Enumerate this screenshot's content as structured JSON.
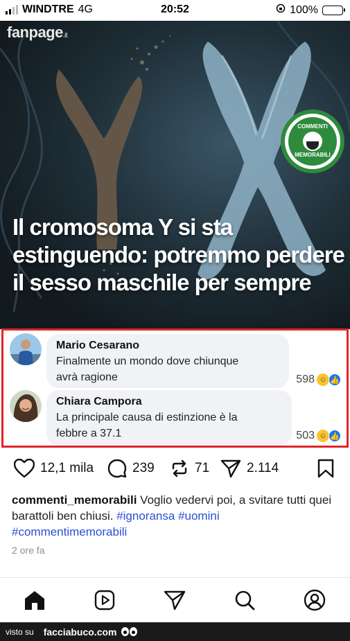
{
  "status_bar": {
    "carrier": "WINDTRE",
    "network": "4G",
    "time": "20:52",
    "battery_percent": "100%",
    "battery_level": 1.0,
    "battery_color": "#f5c400"
  },
  "post_image": {
    "brand": "fanpage",
    "brand_suffix": ".it",
    "headline": "Il cromosoma Y si sta estinguendo: potremmo perdere il sesso maschile per sempre",
    "badge_top": "COMMENTI",
    "badge_bottom": "MEMORABILI",
    "badge_color": "#2e8b3e"
  },
  "comments": [
    {
      "author": "Mario Cesarano",
      "text_line1": "Finalmente un mondo dove chiunque",
      "text_line2": "avrà ragione",
      "reactions": "598"
    },
    {
      "author": "Chiara Campora",
      "text_line1": "La principale causa di estinzione è la",
      "text_line2": "febbre a 37.1",
      "reactions": "503"
    }
  ],
  "highlight_color": "#e0252b",
  "actions": {
    "likes": "12,1 mila",
    "comments": "239",
    "reposts": "71",
    "shares": "2.114"
  },
  "caption": {
    "username": "commenti_memorabili",
    "text": " Voglio vedervi poi, a svitare tutti quei barattoli ben chiusi. ",
    "tag1": "#ignoransa",
    "tag2": "#uomini",
    "tag3": "#commentimemorabili",
    "time_ago": "2 ore fa"
  },
  "bottom_nav": [
    "home-icon",
    "video-icon",
    "send-icon",
    "search-icon",
    "profile-icon"
  ],
  "footer": {
    "visto_su": "visto su",
    "site": "facciabuco.com"
  }
}
